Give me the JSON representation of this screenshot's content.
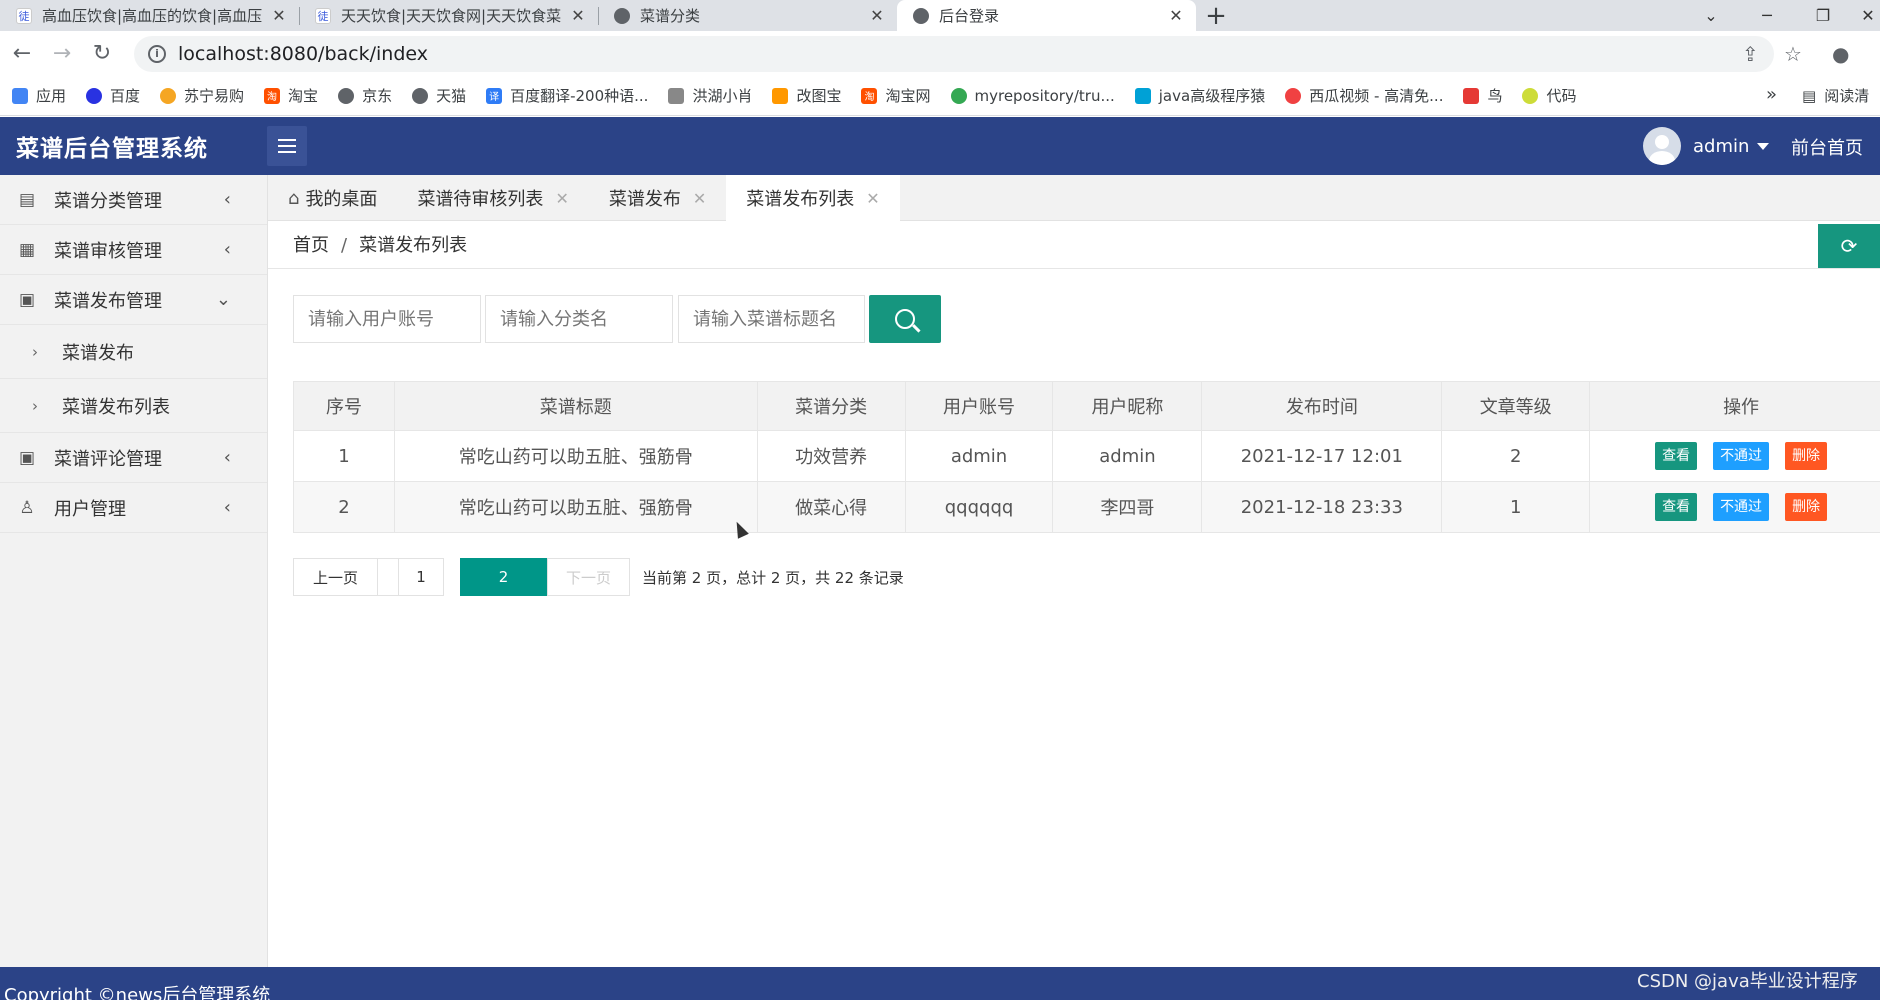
{
  "browser": {
    "tabs": [
      {
        "title": "高血压饮食|高血压的饮食|高血压",
        "favicon": "site-icon",
        "active": false
      },
      {
        "title": "天天饮食|天天饮食网|天天饮食菜",
        "favicon": "site-icon",
        "active": false
      },
      {
        "title": "菜谱分类",
        "favicon": "globe-icon",
        "active": false
      },
      {
        "title": "后台登录",
        "favicon": "globe-icon",
        "active": true
      }
    ],
    "url": "localhost:8080/back/index",
    "bookmarks": [
      {
        "label": "应用",
        "color": "#4285f4"
      },
      {
        "label": "百度",
        "color": "#2932e1"
      },
      {
        "label": "苏宁易购",
        "color": "#f5a623"
      },
      {
        "label": "淘宝",
        "color": "#ff5000"
      },
      {
        "label": "京东",
        "color": "#5f6368"
      },
      {
        "label": "天猫",
        "color": "#5f6368"
      },
      {
        "label": "百度翻译-200种语...",
        "color": "#2f7cf6"
      },
      {
        "label": "洪湖小肖",
        "color": "#888888"
      },
      {
        "label": "改图宝",
        "color": "#ff9800"
      },
      {
        "label": "淘宝网",
        "color": "#ff5000"
      },
      {
        "label": "myrepository/tru...",
        "color": "#34a853"
      },
      {
        "label": "java高级程序猿",
        "color": "#00a1d6"
      },
      {
        "label": "西瓜视频 - 高清免...",
        "color": "#f04142"
      },
      {
        "label": "鸟",
        "color": "#e53935"
      },
      {
        "label": "代码",
        "color": "#cddc39"
      }
    ],
    "bookmarks_more": "»",
    "reading_list": "阅读清"
  },
  "header": {
    "brand": "菜谱后台管理系统",
    "username": "admin",
    "front_link": "前台首页"
  },
  "sidebar": {
    "items": [
      {
        "label": "菜谱分类管理",
        "icon": "document-icon",
        "arrow": "‹"
      },
      {
        "label": "菜谱审核管理",
        "icon": "table-icon",
        "arrow": "‹"
      },
      {
        "label": "菜谱发布管理",
        "icon": "form-icon",
        "arrow": "⌄"
      },
      {
        "label": "菜谱评论管理",
        "icon": "form-icon",
        "arrow": "‹"
      },
      {
        "label": "用户管理",
        "icon": "user-icon",
        "arrow": "‹"
      }
    ],
    "subitems": [
      {
        "label": "菜谱发布"
      },
      {
        "label": "菜谱发布列表"
      }
    ]
  },
  "content_tabs": [
    {
      "label": "我的桌面",
      "closable": false
    },
    {
      "label": "菜谱待审核列表",
      "closable": true
    },
    {
      "label": "菜谱发布",
      "closable": true
    },
    {
      "label": "菜谱发布列表",
      "closable": true,
      "active": true
    }
  ],
  "breadcrumb": {
    "home": "首页",
    "sep": "/",
    "current": "菜谱发布列表"
  },
  "search": {
    "account_placeholder": "请输入用户账号",
    "category_placeholder": "请输入分类名",
    "title_placeholder": "请输入菜谱标题名"
  },
  "table": {
    "headers": [
      "序号",
      "菜谱标题",
      "菜谱分类",
      "用户账号",
      "用户昵称",
      "发布时间",
      "文章等级",
      "操作"
    ],
    "rows": [
      {
        "no": "1",
        "title": "常吃山药可以助五脏、强筋骨",
        "category": "功效营养",
        "account": "admin",
        "nickname": "admin",
        "time": "2021-12-17 12:01",
        "level": "2"
      },
      {
        "no": "2",
        "title": "常吃山药可以助五脏、强筋骨",
        "category": "做菜心得",
        "account": "qqqqqq",
        "nickname": "李四哥",
        "time": "2021-12-18 23:33",
        "level": "1"
      }
    ],
    "actions": {
      "view": "查看",
      "reject": "不通过",
      "delete": "删除"
    }
  },
  "pagination": {
    "prev": "上一页",
    "pages": [
      "1",
      "2"
    ],
    "current": "2",
    "next": "下一页",
    "info": "当前第 2 页，总计 2 页，共 22 条记录"
  },
  "footer": {
    "copyright": "Copyright ©news后台管理系统",
    "watermark": "CSDN @java毕业设计程序"
  }
}
